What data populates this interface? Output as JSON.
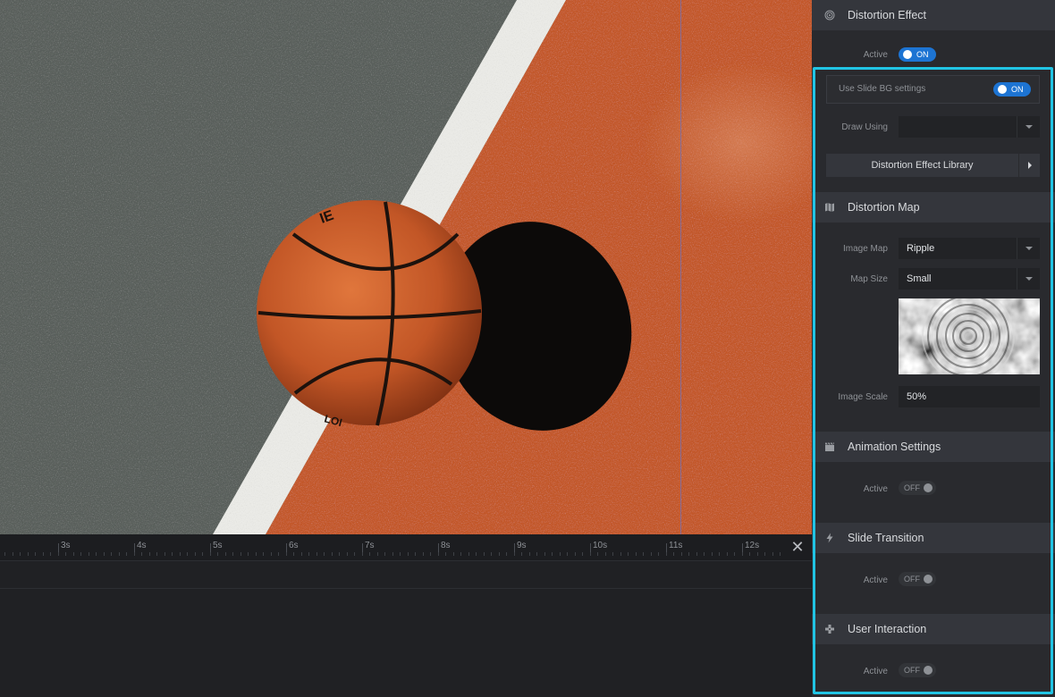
{
  "timeline": {
    "ticks": [
      "3s",
      "4s",
      "5s",
      "6s",
      "7s",
      "8s",
      "9s",
      "10s",
      "11s",
      "12s"
    ],
    "close_icon": "✕"
  },
  "panel": {
    "distortion_effect": {
      "title": "Distortion Effect",
      "icon": "fingerprint-icon",
      "active_label": "Active",
      "active_state": "ON"
    },
    "use_slide_bg": {
      "label": "Use Slide BG settings",
      "state": "ON"
    },
    "draw_using": {
      "label": "Draw Using",
      "value": ""
    },
    "library_button": "Distortion Effect Library",
    "distortion_map": {
      "title": "Distortion Map",
      "icon": "map-icon",
      "image_map_label": "Image Map",
      "image_map_value": "Ripple",
      "map_size_label": "Map Size",
      "map_size_value": "Small",
      "image_scale_label": "Image Scale",
      "image_scale_value": "50%"
    },
    "animation_settings": {
      "title": "Animation Settings",
      "icon": "clapperboard-icon",
      "active_label": "Active",
      "active_state": "OFF"
    },
    "slide_transition": {
      "title": "Slide Transition",
      "icon": "lightning-icon",
      "active_label": "Active",
      "active_state": "OFF"
    },
    "user_interaction": {
      "title": "User Interaction",
      "icon": "gamepad-icon",
      "active_label": "Active",
      "active_state": "OFF"
    }
  },
  "colors": {
    "accent_toggle": "#1d74d3",
    "highlight_border": "#21c4e4",
    "court_orange": "#c4592a",
    "court_gray": "#5a605c"
  }
}
